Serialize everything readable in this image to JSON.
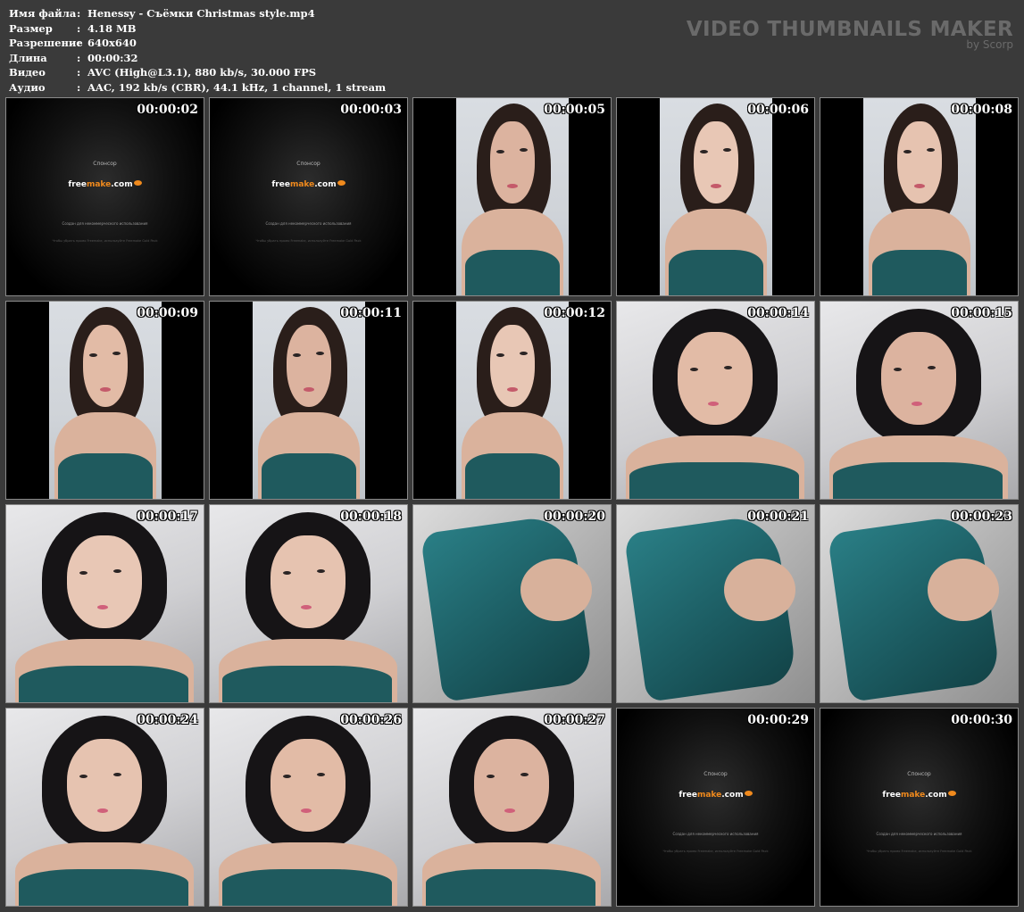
{
  "info": {
    "rows": [
      {
        "label": "Имя файла",
        "sep": ":",
        "value": "Henessy - Съёмки Christmas style.mp4"
      },
      {
        "label": "Размер",
        "sep": ":",
        "value": "4.18 MB"
      },
      {
        "label": "Разрешение",
        "sep": ":",
        "value": "640x640"
      },
      {
        "label": "Длина",
        "sep": ":",
        "value": "00:00:32"
      },
      {
        "label": "Видео",
        "sep": ":",
        "value": "AVC (High@L3.1), 880 kb/s, 30.000 FPS"
      },
      {
        "label": "Аудио",
        "sep": ":",
        "value": "AAC, 192 kb/s (CBR), 44.1 kHz, 1 channel, 1 stream"
      }
    ]
  },
  "brand": {
    "title": "VIDEO THUMBNAILS MAKER",
    "subtitle": "by Scorp"
  },
  "sponsor": {
    "label": "Спонсор",
    "logo_a": "free",
    "logo_b": "make",
    "logo_c": ".com",
    "note": "Создан для некоммерческого использования",
    "note2": "Чтобы убрать промо Freemake, используйте Freemake Gold Pack"
  },
  "thumbnails": [
    {
      "time": "00:00:02",
      "kind": "sponsor"
    },
    {
      "time": "00:00:03",
      "kind": "sponsor"
    },
    {
      "time": "00:00:05",
      "kind": "portrait"
    },
    {
      "time": "00:00:06",
      "kind": "portrait"
    },
    {
      "time": "00:00:08",
      "kind": "portrait"
    },
    {
      "time": "00:00:09",
      "kind": "portrait"
    },
    {
      "time": "00:00:11",
      "kind": "portrait"
    },
    {
      "time": "00:00:12",
      "kind": "portrait"
    },
    {
      "time": "00:00:14",
      "kind": "full"
    },
    {
      "time": "00:00:15",
      "kind": "full"
    },
    {
      "time": "00:00:17",
      "kind": "full"
    },
    {
      "time": "00:00:18",
      "kind": "full"
    },
    {
      "time": "00:00:20",
      "kind": "fabric"
    },
    {
      "time": "00:00:21",
      "kind": "fabric"
    },
    {
      "time": "00:00:23",
      "kind": "fabric"
    },
    {
      "time": "00:00:24",
      "kind": "full"
    },
    {
      "time": "00:00:26",
      "kind": "full"
    },
    {
      "time": "00:00:27",
      "kind": "full"
    },
    {
      "time": "00:00:29",
      "kind": "sponsor"
    },
    {
      "time": "00:00:30",
      "kind": "sponsor"
    }
  ],
  "colors": {
    "background": "#3a3a3a",
    "brand_text": "#6a6a6a",
    "thumb_border": "#8a8a8a",
    "lingerie": "#1f5a5e",
    "freemake_orange": "#f08a1d"
  }
}
